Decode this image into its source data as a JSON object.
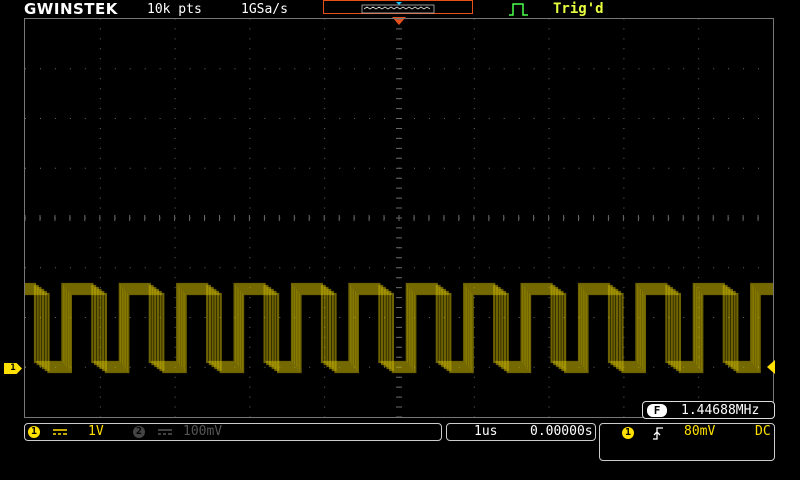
{
  "header": {
    "brand": "GWINSTEK",
    "record_length": "10k pts",
    "sample_rate": "1GSa/s",
    "trigger_status": "Trig'd"
  },
  "measurement": {
    "freq_badge": "F",
    "frequency": "1.44688MHz"
  },
  "channels": {
    "ch1": {
      "badge": "1",
      "scale": "1V",
      "coupling_icon": "dc-coupling-icon"
    },
    "ch2": {
      "badge": "2",
      "scale": "100mV",
      "coupling_icon": "dc-coupling-icon"
    }
  },
  "timebase": {
    "scale": "1us",
    "position": "0.00000s"
  },
  "trigger": {
    "source": "1",
    "slope_icon": "rising-edge-icon",
    "level": "80mV",
    "coupling": "DC"
  },
  "markers": {
    "ch1_ground_label": "1"
  },
  "colors": {
    "ch1": "#ffe000",
    "trace": "#c9b400",
    "accent": "#e8501a",
    "trig": "#4cff4c"
  }
}
